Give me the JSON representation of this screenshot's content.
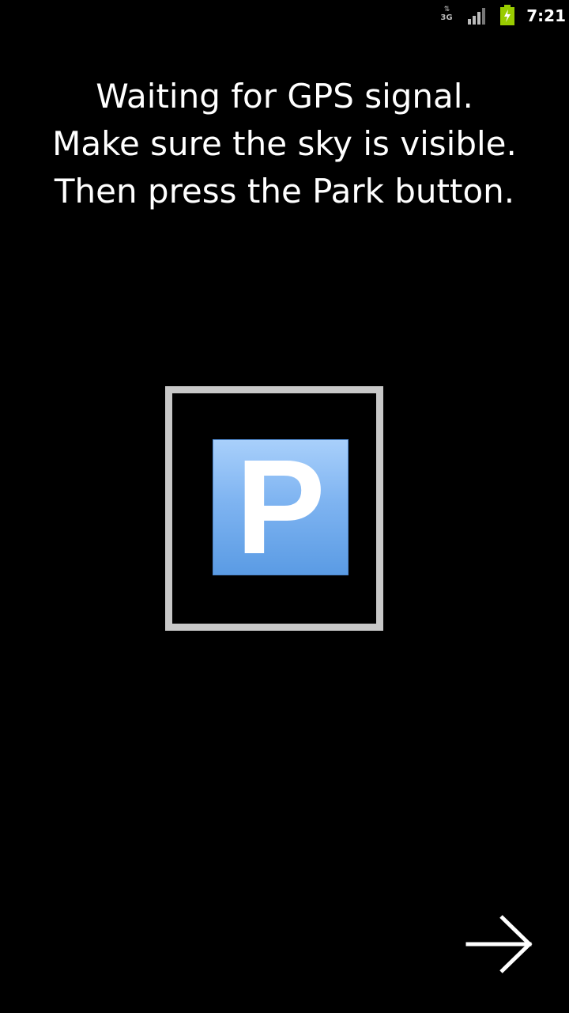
{
  "status_bar": {
    "network_type": "3G",
    "network_arrows": "⇅",
    "time": "7:21",
    "signal_icon": "signal-bars-icon",
    "battery_icon": "battery-charging-icon",
    "battery_color": "#99cc00"
  },
  "message": {
    "line1": "Waiting for GPS signal.",
    "line2": "Make sure the sky is visible.",
    "line3": "Then press the Park button."
  },
  "park_button": {
    "letter": "P",
    "icon": "parking-sign-icon",
    "icon_color": "#5a9be4"
  },
  "navigation": {
    "next_icon": "arrow-right-icon"
  }
}
